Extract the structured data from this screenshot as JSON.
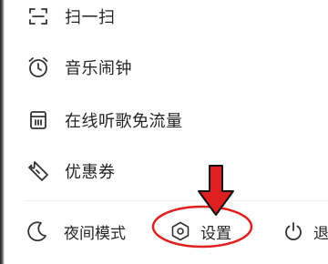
{
  "menu": {
    "items": [
      {
        "label": "扫一扫",
        "icon": "scan-icon"
      },
      {
        "label": "音乐闹钟",
        "icon": "alarm-clock-icon"
      },
      {
        "label": "在线听歌免流量",
        "icon": "data-card-icon"
      },
      {
        "label": "优惠券",
        "icon": "coupon-icon"
      }
    ]
  },
  "bottom_bar": {
    "night_mode": {
      "label": "夜间模式",
      "icon": "moon-icon"
    },
    "settings": {
      "label": "设置",
      "icon": "hexagon-gear-icon"
    },
    "exit": {
      "label": "退",
      "icon": "power-icon"
    }
  },
  "annotation": {
    "color": "#e02020",
    "target": "settings",
    "shapes": [
      "down-arrow",
      "ellipse-ring"
    ]
  },
  "colors": {
    "text": "#252525",
    "icon": "#333333",
    "background": "#ffffff",
    "divider": "#ededed"
  }
}
